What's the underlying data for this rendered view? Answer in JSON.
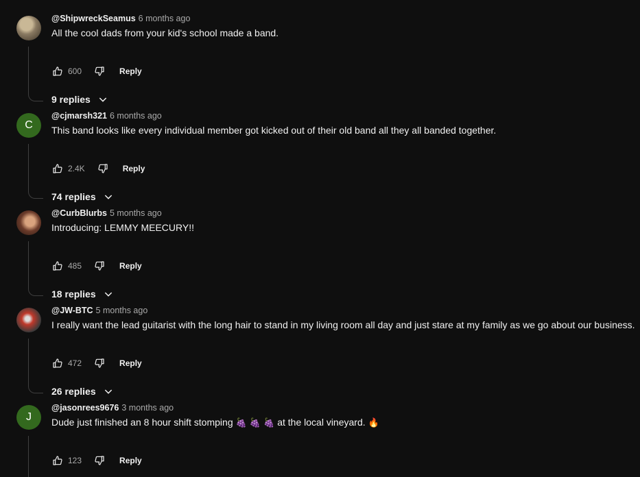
{
  "comments": [
    {
      "handle": "@ShipwreckSeamus",
      "time": "6 months ago",
      "text": "All the cool dads from your kid's school made a band.",
      "likes": "600",
      "reply_label": "Reply",
      "replies_label": "9 replies",
      "avatar": {
        "type": "image",
        "colors": [
          "#8a7a62",
          "#c9b896",
          "#3b3226"
        ]
      }
    },
    {
      "handle": "@cjmarsh321",
      "time": "6 months ago",
      "text": "This band looks like every individual member got kicked out of their old band all they all banded together.",
      "likes": "2.4K",
      "reply_label": "Reply",
      "replies_label": "74 replies",
      "avatar": {
        "type": "letter",
        "letter": "C",
        "color": "#33691e"
      }
    },
    {
      "handle": "@CurbBlurbs",
      "time": "5 months ago",
      "text": "Introducing: LEMMY MEECURY!!",
      "likes": "485",
      "reply_label": "Reply",
      "replies_label": "18 replies",
      "avatar": {
        "type": "image",
        "colors": [
          "#6b3b2a",
          "#d9a37e",
          "#2a1a14"
        ]
      }
    },
    {
      "handle": "@JW-BTC",
      "time": "5 months ago",
      "text": "I really want the lead guitarist with the long hair to stand in my living room all day and just stare at my family as we go about our business.",
      "likes": "472",
      "reply_label": "Reply",
      "replies_label": "26 replies",
      "avatar": {
        "type": "image",
        "colors": [
          "#3a3a3a",
          "#c0392b",
          "#dddddd"
        ]
      }
    },
    {
      "handle": "@jasonrees9676",
      "time": "3 months ago",
      "text_parts": [
        "Dude just finished an 8 hour shift stomping ",
        "🍇 🍇 🍇",
        " at the local vineyard. ",
        "🔥"
      ],
      "likes": "123",
      "reply_label": "Reply",
      "avatar": {
        "type": "letter",
        "letter": "J",
        "color": "#33691e"
      }
    }
  ],
  "icons": {
    "like": "thumbs-up-icon",
    "dislike": "thumbs-down-icon",
    "expand": "chevron-down-icon"
  }
}
